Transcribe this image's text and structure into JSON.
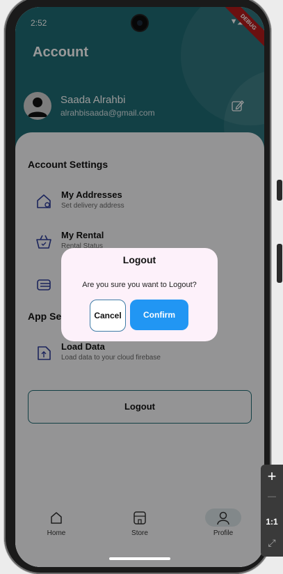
{
  "status_bar": {
    "time": "2:52",
    "icons": "▼◢▮"
  },
  "debug_banner": "DEBUG",
  "header": {
    "title": "Account"
  },
  "profile": {
    "name": "Saada Alrahbi",
    "email": "alrahbisaada@gmail.com"
  },
  "account_settings": {
    "heading": "Account Settings",
    "items": [
      {
        "label": "My Addresses",
        "subtitle": "Set delivery address",
        "icon": "home-location-icon"
      },
      {
        "label": "My Rental",
        "subtitle": "Rental Status",
        "icon": "basket-icon"
      },
      {
        "label": "",
        "subtitle": "",
        "icon": "card-icon"
      }
    ]
  },
  "app_settings": {
    "heading": "App Settings",
    "items": [
      {
        "label": "Load Data",
        "subtitle": "Load data to your cloud firebase",
        "icon": "document-upload-icon"
      }
    ]
  },
  "logout_button": "Logout",
  "bottom_nav": [
    {
      "label": "Home",
      "icon": "home-icon"
    },
    {
      "label": "Store",
      "icon": "store-icon"
    },
    {
      "label": "Profile",
      "icon": "user-icon",
      "selected": true
    }
  ],
  "dialog": {
    "title": "Logout",
    "message": "Are you sure you want to Logout?",
    "cancel": "Cancel",
    "confirm": "Confirm"
  },
  "zoom_controls": {
    "plus": "+",
    "minus": "—",
    "ratio": "1:1",
    "fit": "⤢"
  },
  "colors": {
    "header": "#1f6b73",
    "accent": "#2196f3",
    "dialog_bg": "#fdf1fa"
  }
}
